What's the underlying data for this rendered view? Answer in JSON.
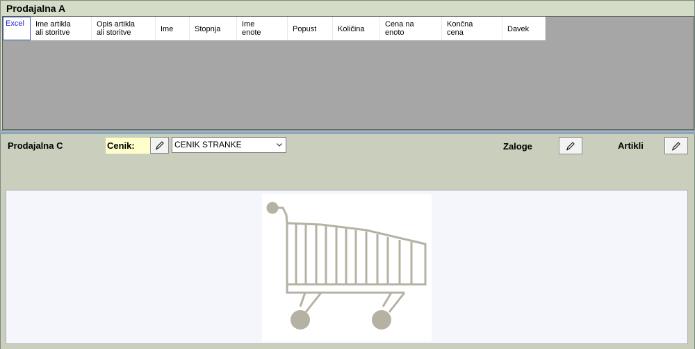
{
  "panel_a": {
    "title": "Prodajalna A",
    "columns": [
      {
        "label": "Excel"
      },
      {
        "label": "Ime artikla\nali storitve"
      },
      {
        "label": "Opis artikla\nali storitve"
      },
      {
        "label": "Ime"
      },
      {
        "label": "Stopnja"
      },
      {
        "label": "Ime\nenote"
      },
      {
        "label": "Popust"
      },
      {
        "label": "Količina"
      },
      {
        "label": "Cena na\nenoto"
      },
      {
        "label": "Končna\ncena"
      },
      {
        "label": "Davek"
      }
    ]
  },
  "panel_c": {
    "title": "Prodajalna C",
    "cenik_label": "Cenik:",
    "cenik_selected": "CENIK STRANKE",
    "zaloge_label": "Zaloge",
    "artikli_label": "Artikli"
  },
  "icons": {
    "edit": "pencil-icon",
    "dropdown": "chevron-down-icon",
    "image": "shopping-cart-icon"
  },
  "colors": {
    "grid_bg": "#a6a6a6",
    "cenik_highlight": "#ffffcc",
    "excel_text": "#2222cc",
    "cart_gray": "#b5b1a3"
  }
}
